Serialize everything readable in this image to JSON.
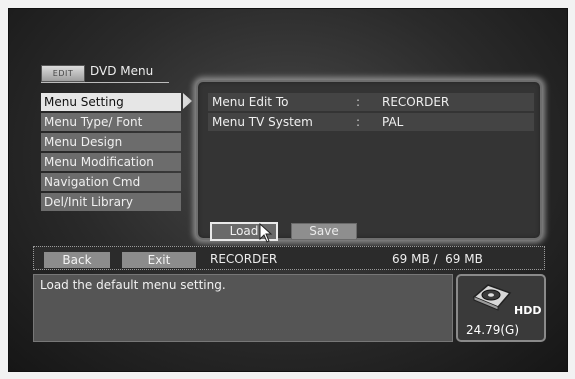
{
  "header": {
    "badge": "EDIT",
    "title": "DVD Menu"
  },
  "left_menu": {
    "items": [
      {
        "label": "Menu Setting",
        "selected": true
      },
      {
        "label": "Menu Type/ Font",
        "selected": false
      },
      {
        "label": "Menu Design",
        "selected": false
      },
      {
        "label": "Menu Modification",
        "selected": false
      },
      {
        "label": "Navigation Cmd",
        "selected": false
      },
      {
        "label": "Del/Init Library",
        "selected": false
      }
    ]
  },
  "settings": {
    "rows": [
      {
        "label": "Menu Edit To",
        "separator": ":",
        "value": "RECORDER"
      },
      {
        "label": "Menu TV System",
        "separator": ":",
        "value": "PAL"
      }
    ],
    "load_label": "Load",
    "save_label": "Save"
  },
  "status_bar": {
    "back_label": "Back",
    "exit_label": "Exit",
    "source": "RECORDER",
    "size": "69 MB /  69 MB"
  },
  "help_text": "Load the default menu setting.",
  "hdd": {
    "label": "HDD",
    "capacity": "24.79(G)",
    "icon": "hdd-icon"
  },
  "icons": {
    "cursor": "mouse-cursor-icon",
    "arrow": "selection-arrow-icon"
  },
  "colors": {
    "highlight": "#e6e6e6",
    "panel": "#343434",
    "menu_item": "#6c6c6c"
  }
}
